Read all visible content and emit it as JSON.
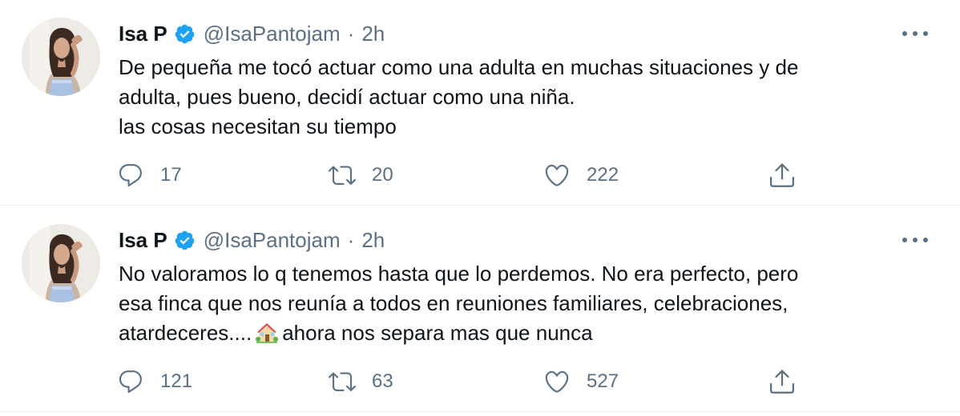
{
  "tweets": [
    {
      "author": {
        "name": "Isa P",
        "handle": "@IsaPantojam",
        "verified": true,
        "avatar": "profile-photo"
      },
      "separator": "·",
      "time": "2h",
      "text_lines": [
        "De pequeña me tocó actuar como una adulta en muchas situaciones y de",
        "adulta, pues bueno, decidí actuar como una niña.",
        "las cosas necesitan su tiempo"
      ],
      "stats": {
        "replies": "17",
        "retweets": "20",
        "likes": "222"
      }
    },
    {
      "author": {
        "name": "Isa P",
        "handle": "@IsaPantojam",
        "verified": true,
        "avatar": "profile-photo"
      },
      "separator": "·",
      "time": "2h",
      "text_lines": [
        "No valoramos lo q tenemos hasta que lo perdemos. No era perfecto, pero",
        "esa finca que nos reunía a todos en reuniones familiares, celebraciones,"
      ],
      "text_line_3_before": "atardeceres....",
      "text_line_3_emoji": "house-with-garden-emoji",
      "text_line_3_after": "ahora nos separa mas que nunca",
      "stats": {
        "replies": "121",
        "retweets": "63",
        "likes": "527"
      }
    }
  ],
  "colors": {
    "text_primary": "#0f1419",
    "text_secondary": "#5b7083",
    "verified_blue": "#1da1f2",
    "divider": "#ebeef0"
  },
  "icons": {
    "reply": "speech-bubble-icon",
    "retweet": "retweet-arrows-icon",
    "like": "heart-icon",
    "share": "share-upload-icon",
    "more": "more-dots-icon",
    "verified": "verified-badge-icon"
  }
}
